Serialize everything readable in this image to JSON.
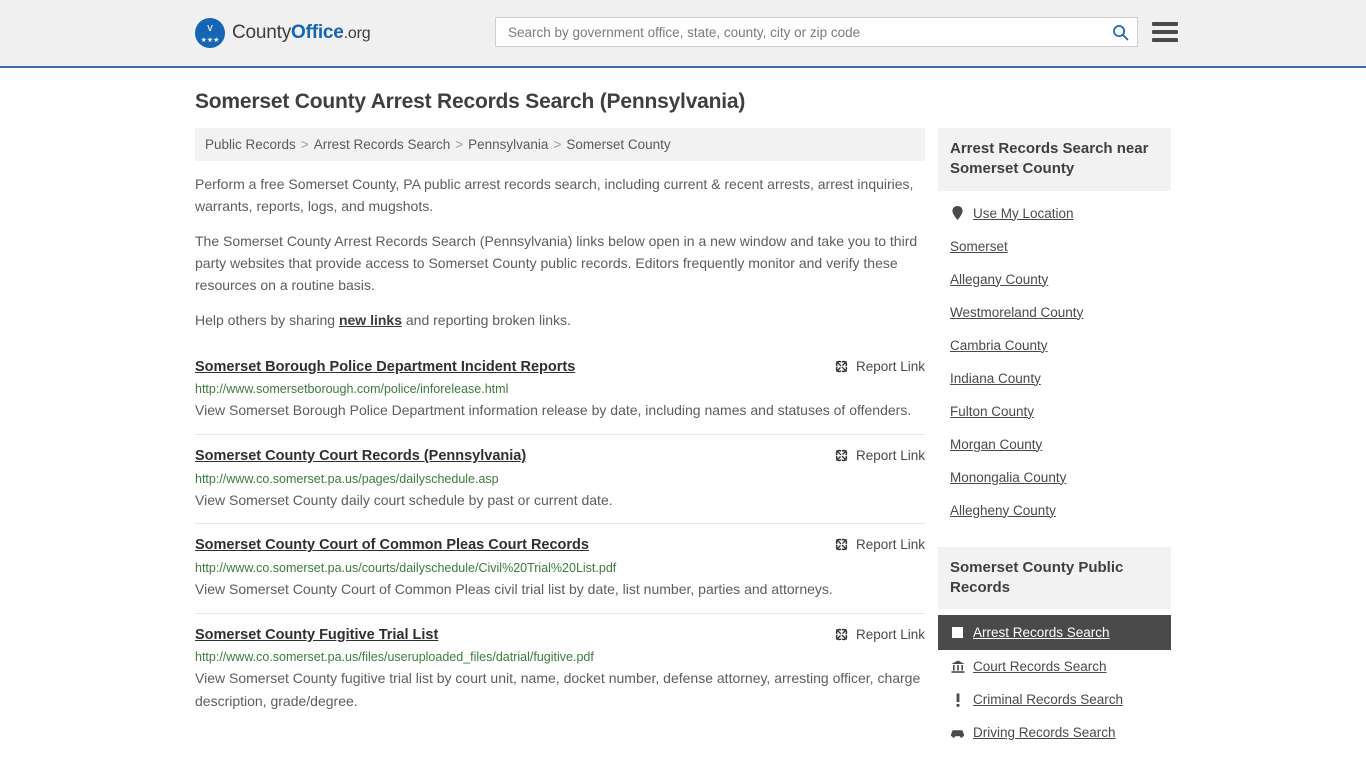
{
  "header": {
    "logo": {
      "part1": "County",
      "part2": "Office",
      "part3": ".org",
      "eagle_glyph": "ᴠ",
      "stars_glyph": "★★★"
    },
    "search": {
      "placeholder": "Search by government office, state, county, city or zip code",
      "value": ""
    }
  },
  "page": {
    "title": "Somerset County Arrest Records Search (Pennsylvania)"
  },
  "breadcrumb": {
    "items": [
      {
        "label": "Public Records"
      },
      {
        "label": "Arrest Records Search"
      },
      {
        "label": "Pennsylvania"
      },
      {
        "label": "Somerset County"
      }
    ],
    "separator": ">"
  },
  "intro": {
    "p1": "Perform a free Somerset County, PA public arrest records search, including current & recent arrests, arrest inquiries, warrants, reports, logs, and mugshots.",
    "p2": "The Somerset County Arrest Records Search (Pennsylvania) links below open in a new window and take you to third party websites that provide access to Somerset County public records. Editors frequently monitor and verify these resources on a routine basis.",
    "p3_before": "Help others by sharing ",
    "p3_link": "new links",
    "p3_after": " and reporting broken links."
  },
  "report_link_label": "Report Link",
  "results": [
    {
      "title": "Somerset Borough Police Department Incident Reports",
      "url": "http://www.somersetborough.com/police/inforelease.html",
      "description": "View Somerset Borough Police Department information release by date, including names and statuses of offenders."
    },
    {
      "title": "Somerset County Court Records (Pennsylvania)",
      "url": "http://www.co.somerset.pa.us/pages/dailyschedule.asp",
      "description": "View Somerset County daily court schedule by past or current date."
    },
    {
      "title": "Somerset County Court of Common Pleas Court Records",
      "url": "http://www.co.somerset.pa.us/courts/dailyschedule/Civil%20Trial%20List.pdf",
      "description": "View Somerset County Court of Common Pleas civil trial list by date, list number, parties and attorneys."
    },
    {
      "title": "Somerset County Fugitive Trial List",
      "url": "http://www.co.somerset.pa.us/files/useruploaded_files/datrial/fugitive.pdf",
      "description": "View Somerset County fugitive trial list by court unit, name, docket number, defense attorney, arresting officer, charge description, grade/degree."
    }
  ],
  "sidebar": {
    "nearby": {
      "heading": "Arrest Records Search near Somerset County",
      "items": [
        {
          "label": "Use My Location",
          "icon": "location-pin-icon"
        },
        {
          "label": "Somerset",
          "icon": ""
        },
        {
          "label": "Allegany County",
          "icon": ""
        },
        {
          "label": "Westmoreland County",
          "icon": ""
        },
        {
          "label": "Cambria County",
          "icon": ""
        },
        {
          "label": "Indiana County",
          "icon": ""
        },
        {
          "label": "Fulton County",
          "icon": ""
        },
        {
          "label": "Morgan County",
          "icon": ""
        },
        {
          "label": "Monongalia County",
          "icon": ""
        },
        {
          "label": "Allegheny County",
          "icon": ""
        }
      ]
    },
    "public_records": {
      "heading": "Somerset County Public Records",
      "items": [
        {
          "label": "Arrest Records Search",
          "icon": "square-icon",
          "active": true
        },
        {
          "label": "Court Records Search",
          "icon": "bank-icon",
          "active": false
        },
        {
          "label": "Criminal Records Search",
          "icon": "exclamation-icon",
          "active": false
        },
        {
          "label": "Driving Records Search",
          "icon": "car-icon",
          "active": false
        }
      ]
    }
  },
  "colors": {
    "accent_blue": "#1565b5",
    "header_border": "#3a6ea5",
    "url_green": "#3e7a3e",
    "active_dark": "#4a4a4a"
  }
}
